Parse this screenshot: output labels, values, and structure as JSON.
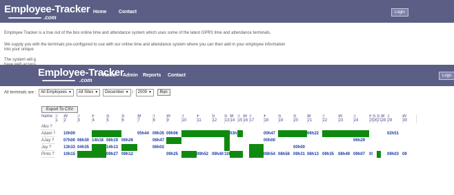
{
  "background_page": {
    "logo": {
      "brand": "Employee-Tracker",
      "suffix": ".com"
    },
    "nav": [
      "Home",
      "Contact"
    ],
    "login_label": "Login",
    "intro_text": "Employee Tracker is a true out of the box online time and attendance system which uses some of the latest GPRS time and attendance terminals.",
    "line2_text": "We supply you with the terminals pre-configured to use with our online time and attendance system where you can then add in your employee information",
    "line2_cont": "into your unique",
    "line3_text": "The system will g",
    "line3_cont": "have web access"
  },
  "header": {
    "logo": {
      "brand": "Employee-Tracker",
      "suffix": ".com"
    },
    "nav": [
      "Home",
      "Admin",
      "Reports",
      "Contact"
    ],
    "logout_label": "Logo"
  },
  "filters": {
    "label": "All terminals are :",
    "employees": "All Employees",
    "sites": "All Sites",
    "month": "December",
    "separator": "/",
    "year": "2009",
    "run_label": "Run"
  },
  "export_label": "Export To CSV",
  "calendar": {
    "name_header": "Name",
    "days": [
      {
        "dow": "T",
        "num": "1"
      },
      {
        "dow": "W",
        "num": "2"
      },
      {
        "dow": "T",
        "num": "3"
      },
      {
        "dow": "F",
        "num": "4"
      },
      {
        "dow": "S",
        "num": "5"
      },
      {
        "dow": "S",
        "num": "6"
      },
      {
        "dow": "M",
        "num": "7"
      },
      {
        "dow": "T",
        "num": "8"
      },
      {
        "dow": "W",
        "num": "9"
      },
      {
        "dow": "T",
        "num": "10"
      },
      {
        "dow": "F",
        "num": "11"
      },
      {
        "dow": "S",
        "num": "12"
      },
      {
        "dow": "S",
        "num": "13"
      },
      {
        "dow": "M",
        "num": "14"
      },
      {
        "dow": "T",
        "num": "15"
      },
      {
        "dow": "W",
        "num": "16"
      },
      {
        "dow": "T",
        "num": "17"
      },
      {
        "dow": "F",
        "num": "18"
      },
      {
        "dow": "S",
        "num": "19"
      },
      {
        "dow": "S",
        "num": "20"
      },
      {
        "dow": "M",
        "num": "21"
      },
      {
        "dow": "T",
        "num": "22"
      },
      {
        "dow": "W",
        "num": "23"
      },
      {
        "dow": "T",
        "num": "24"
      },
      {
        "dow": "F",
        "num": "25"
      },
      {
        "dow": "S",
        "num": "26"
      },
      {
        "dow": "S",
        "num": "27"
      },
      {
        "dow": "M",
        "num": "28"
      },
      {
        "dow": "T",
        "num": "29"
      },
      {
        "dow": "W",
        "num": "30"
      }
    ],
    "rows": [
      {
        "name": "Abu ?",
        "cells": []
      },
      {
        "name": "Adam ?",
        "cells": [
          {
            "start": 1,
            "span": 2,
            "text": "10h00"
          },
          {
            "start": 3,
            "span": 2,
            "text": ""
          },
          {
            "start": 6,
            "span": 1,
            "text": "05h44"
          },
          {
            "start": 7,
            "span": 1,
            "text": "09h35"
          },
          {
            "start": 8,
            "span": 1,
            "text": "09h06"
          },
          {
            "start": 9,
            "span": 4,
            "text": ""
          },
          {
            "start": 13,
            "span": 1,
            "text": "03h30"
          },
          {
            "start": 14,
            "span": 1,
            "text": ""
          },
          {
            "start": 17,
            "span": 1,
            "text": "00h47"
          },
          {
            "start": 18,
            "span": 2,
            "text": ""
          },
          {
            "start": 20,
            "span": 1,
            "text": "06h22"
          },
          {
            "start": 21,
            "span": 3,
            "text": ""
          },
          {
            "start": 28,
            "span": 1,
            "text": "02h51"
          }
        ]
      },
      {
        "name": "AJay ?",
        "cells": [
          {
            "start": 1,
            "span": 1,
            "text": "07h00"
          },
          {
            "start": 2,
            "span": 1,
            "text": "06h30"
          },
          {
            "start": 3,
            "span": 1,
            "text": "14h18"
          },
          {
            "start": 4,
            "span": 1,
            "text": "06h19"
          },
          {
            "start": 5,
            "span": 1,
            "text": "06h26"
          },
          {
            "start": 7,
            "span": 1,
            "text": "06h47"
          },
          {
            "start": 8,
            "span": 1,
            "text": ""
          },
          {
            "start": 12,
            "span": 1,
            "text": ""
          },
          {
            "start": 17,
            "span": 1,
            "text": "00h00"
          },
          {
            "start": 23,
            "span": 1,
            "text": "06h29"
          }
        ]
      },
      {
        "name": "Jay ?",
        "cells": [
          {
            "start": 1,
            "span": 1,
            "text": "13h33"
          },
          {
            "start": 2,
            "span": 1,
            "text": "04h35"
          },
          {
            "start": 3,
            "span": 1,
            "text": ""
          },
          {
            "start": 4,
            "span": 1,
            "text": "14h13"
          },
          {
            "start": 5,
            "span": 1,
            "text": ""
          },
          {
            "start": 7,
            "span": 1,
            "text": "06h02"
          },
          {
            "start": 12,
            "span": 1,
            "text": ""
          },
          {
            "start": 16,
            "span": 1,
            "text": ""
          },
          {
            "start": 19,
            "span": 1,
            "text": "00h00"
          }
        ]
      },
      {
        "name": "Pinto ?",
        "cells": [
          {
            "start": 1,
            "span": 1,
            "text": "10h15"
          },
          {
            "start": 2,
            "span": 2,
            "text": ""
          },
          {
            "start": 4,
            "span": 1,
            "text": "09h27"
          },
          {
            "start": 5,
            "span": 1,
            "text": "09h12"
          },
          {
            "start": 8,
            "span": 1,
            "text": "09h25"
          },
          {
            "start": 9,
            "span": 1,
            "text": ""
          },
          {
            "start": 10,
            "span": 1,
            "text": "09h52"
          },
          {
            "start": 11,
            "span": 1,
            "text": "09h40"
          },
          {
            "start": 12,
            "span": 1,
            "text": "10h01"
          },
          {
            "start": 13,
            "span": 1,
            "text": ""
          },
          {
            "start": 14,
            "span": 1,
            "text": ""
          },
          {
            "start": 16,
            "span": 1,
            "text": ""
          },
          {
            "start": 17,
            "span": 1,
            "text": "08h54"
          },
          {
            "start": 18,
            "span": 1,
            "text": "08h56"
          },
          {
            "start": 19,
            "span": 1,
            "text": "09h31"
          },
          {
            "start": 20,
            "span": 1,
            "text": "08h13"
          },
          {
            "start": 21,
            "span": 1,
            "text": "09h35"
          },
          {
            "start": 22,
            "span": 1,
            "text": "08h49"
          },
          {
            "start": 23,
            "span": 1,
            "text": "09h07"
          },
          {
            "start": 24,
            "span": 1,
            "text": "09h51"
          },
          {
            "start": 26,
            "span": 1,
            "text": ""
          },
          {
            "start": 28,
            "span": 1,
            "text": "09h03"
          },
          {
            "start": 29,
            "span": 1,
            "text": "09"
          }
        ]
      }
    ]
  }
}
